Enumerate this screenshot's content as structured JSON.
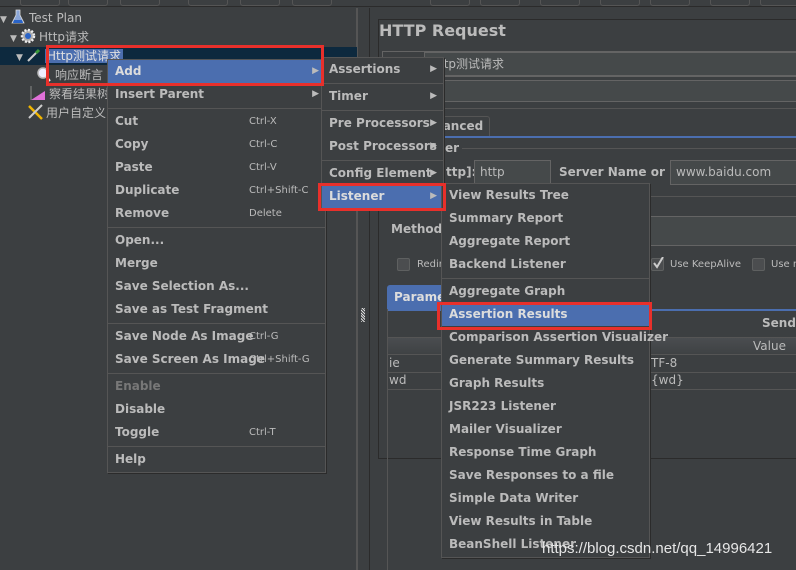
{
  "tree": {
    "items": [
      {
        "label": "Test Plan",
        "icon": "flask-icon",
        "expanded": true
      },
      {
        "label": "Http请求",
        "icon": "thread-group-gear-icon",
        "expanded": true
      },
      {
        "label": "Http测试请求",
        "icon": "pipette-sampler-icon",
        "expanded": true,
        "selected": true
      },
      {
        "label": "响应断言",
        "icon": "magnifier-assertion-icon"
      },
      {
        "label": "察看结果树",
        "icon": "graph-listener-icon"
      },
      {
        "label": "用户自定义",
        "icon": "wrench-config-icon"
      }
    ]
  },
  "http_request": {
    "title": "HTTP Request",
    "name_value": "Http测试请求",
    "tab_advanced": "Advanced",
    "section_fragment": "er",
    "protocol_label": "ttp]:",
    "protocol_value": "http",
    "server_label": "Server Name or IP:",
    "server_value": "www.baidu.com",
    "method_label": "Method:",
    "redirect_label": "Redir",
    "keepalive_label": "Use KeepAlive",
    "keepalive_checked": true,
    "multipart_label": "Use n",
    "parameters_tab": "Paramet",
    "send_params_label": "Send P",
    "value_header": "Value",
    "params": [
      {
        "name": "ie",
        "value": "TF-8"
      },
      {
        "name": "wd",
        "value": "{wd}"
      }
    ]
  },
  "context_menu": {
    "items": [
      {
        "label": "Add",
        "submenu": true,
        "highlighted": true
      },
      {
        "label": "Insert Parent",
        "submenu": true
      },
      {
        "label": "Cut",
        "shortcut": "Ctrl-X"
      },
      {
        "label": "Copy",
        "shortcut": "Ctrl-C"
      },
      {
        "label": "Paste",
        "shortcut": "Ctrl-V"
      },
      {
        "label": "Duplicate",
        "shortcut": "Ctrl+Shift-C"
      },
      {
        "label": "Remove",
        "shortcut": "Delete"
      },
      {
        "label": "Open..."
      },
      {
        "label": "Merge"
      },
      {
        "label": "Save Selection As..."
      },
      {
        "label": "Save as Test Fragment"
      },
      {
        "label": "Save Node As Image",
        "shortcut": "Ctrl-G"
      },
      {
        "label": "Save Screen As Image",
        "shortcut": "Ctrl+Shift-G"
      },
      {
        "label": "Enable",
        "disabled": true
      },
      {
        "label": "Disable"
      },
      {
        "label": "Toggle",
        "shortcut": "Ctrl-T"
      },
      {
        "label": "Help"
      }
    ]
  },
  "add_submenu": {
    "items": [
      {
        "label": "Assertions"
      },
      {
        "label": "Timer"
      },
      {
        "label": "Pre Processors"
      },
      {
        "label": "Post Processors"
      },
      {
        "label": "Config Element"
      },
      {
        "label": "Listener",
        "highlighted": true
      }
    ]
  },
  "listener_submenu": {
    "items": [
      {
        "label": "View Results Tree"
      },
      {
        "label": "Summary Report"
      },
      {
        "label": "Aggregate Report"
      },
      {
        "label": "Backend Listener"
      },
      {
        "label": "Aggregate Graph"
      },
      {
        "label": "Assertion Results",
        "highlighted": true
      },
      {
        "label": "Comparison Assertion Visualizer"
      },
      {
        "label": "Generate Summary Results"
      },
      {
        "label": "Graph Results"
      },
      {
        "label": "JSR223 Listener"
      },
      {
        "label": "Mailer Visualizer"
      },
      {
        "label": "Response Time Graph"
      },
      {
        "label": "Save Responses to a file"
      },
      {
        "label": "Simple Data Writer"
      },
      {
        "label": "View Results in Table"
      },
      {
        "label": "BeanShell Listener"
      }
    ]
  },
  "colors": {
    "background": "#3c3f41",
    "highlight": "#4b6eaf",
    "annotation_red": "#e8302b",
    "text": "#bbbbbb"
  },
  "watermark": "https://blog.csdn.net/qq_14996421"
}
